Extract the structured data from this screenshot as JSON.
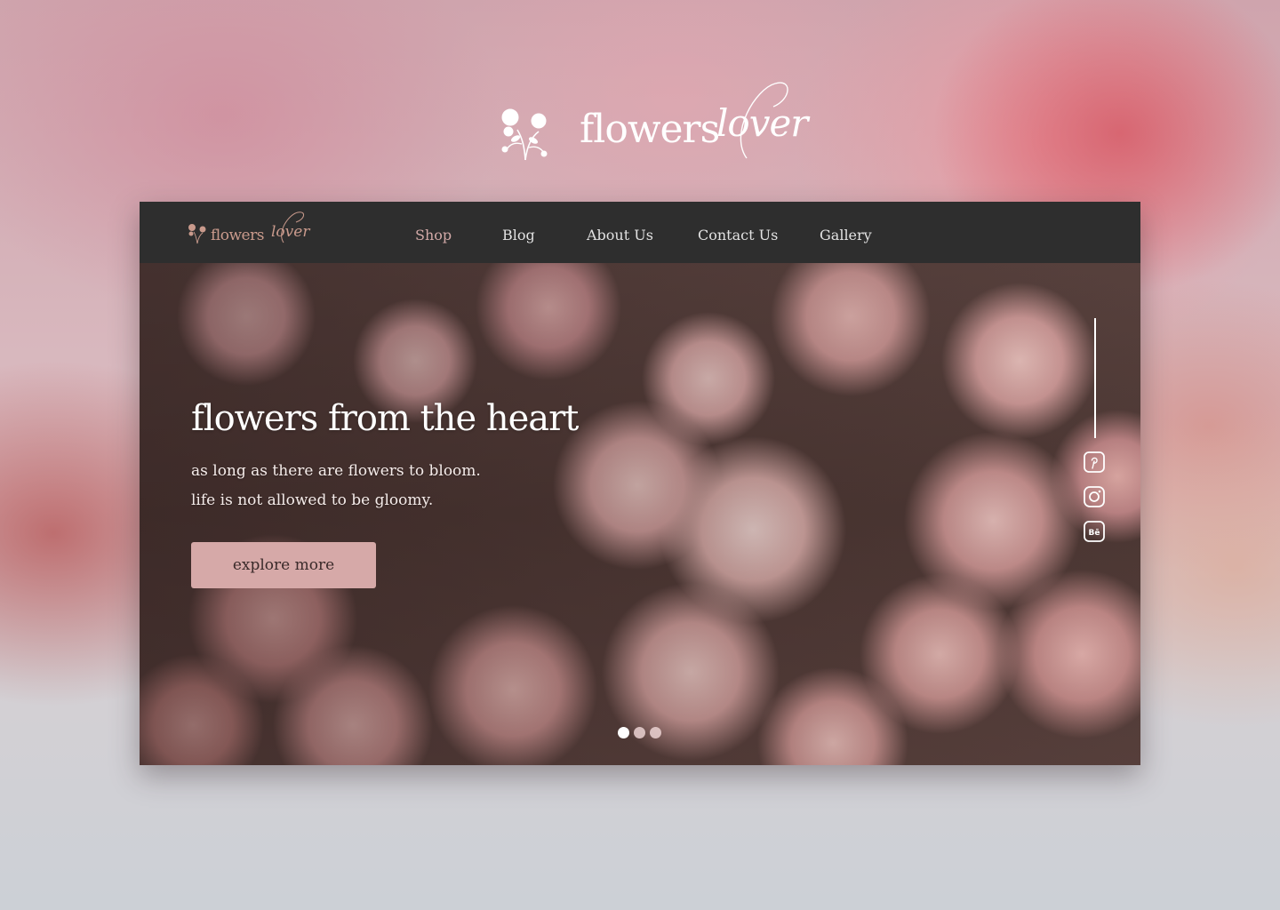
{
  "brand": {
    "word": "flowers",
    "script": "lover"
  },
  "nav": {
    "items": [
      {
        "label": "Shop",
        "active": true
      },
      {
        "label": "Blog",
        "active": false
      },
      {
        "label": "About Us",
        "active": false
      },
      {
        "label": "Contact Us",
        "active": false
      },
      {
        "label": "Gallery",
        "active": false
      }
    ]
  },
  "hero": {
    "title": "flowers from the heart",
    "subtitle_line1": "as long as there are flowers to bloom.",
    "subtitle_line2": "life is not allowed to be gloomy.",
    "cta_label": "explore more"
  },
  "social": {
    "icons": [
      "pinterest-icon",
      "instagram-icon",
      "behance-icon"
    ],
    "behance_text": "Bē"
  },
  "carousel": {
    "slide_count": 3,
    "active_index": 0
  },
  "colors": {
    "navbar_bg": "#2e2e2e",
    "accent_pink": "#d6a9a8",
    "active_nav": "#d3aaa8",
    "logo_gold": "#c99a8c"
  }
}
